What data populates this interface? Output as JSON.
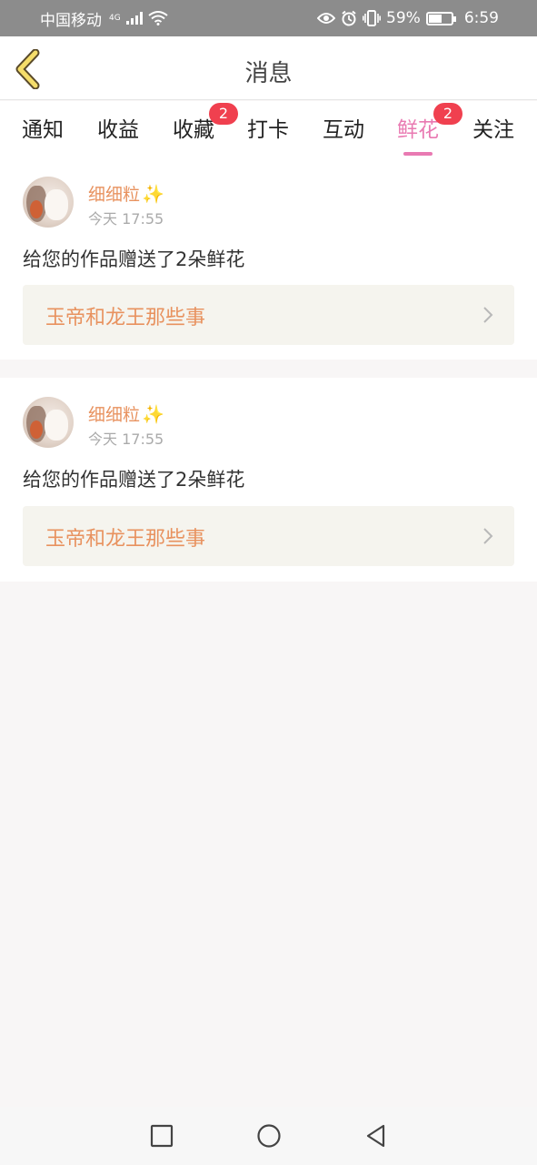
{
  "status_bar": {
    "carrier": "中国移动",
    "network": "4G",
    "battery_pct": "59%",
    "battery_level": 0.59,
    "time": "6:59"
  },
  "header": {
    "title": "消息"
  },
  "tabs": [
    {
      "label": "通知",
      "badge": ""
    },
    {
      "label": "收益",
      "badge": ""
    },
    {
      "label": "收藏",
      "badge": "2"
    },
    {
      "label": "打卡",
      "badge": ""
    },
    {
      "label": "互动",
      "badge": ""
    },
    {
      "label": "鲜花",
      "badge": "2",
      "active": true
    },
    {
      "label": "关注",
      "badge": ""
    }
  ],
  "messages": [
    {
      "username": "细细粒",
      "sparkle": "✨",
      "time": "今天 17:55",
      "text": "给您的作品赠送了2朵鲜花",
      "work_title": "玉帝和龙王那些事"
    },
    {
      "username": "细细粒",
      "sparkle": "✨",
      "time": "今天 17:55",
      "text": "给您的作品赠送了2朵鲜花",
      "work_title": "玉帝和龙王那些事"
    }
  ],
  "colors": {
    "accent": "#e97ab2",
    "username": "#e8925f",
    "badge": "#f0404f"
  },
  "icons": [
    "back-arrow-icon",
    "eye-icon",
    "alarm-icon",
    "vibrate-icon",
    "wifi-icon",
    "signal-icon",
    "battery-icon",
    "chevron-right-icon",
    "recent-apps-icon",
    "home-icon",
    "back-icon"
  ]
}
